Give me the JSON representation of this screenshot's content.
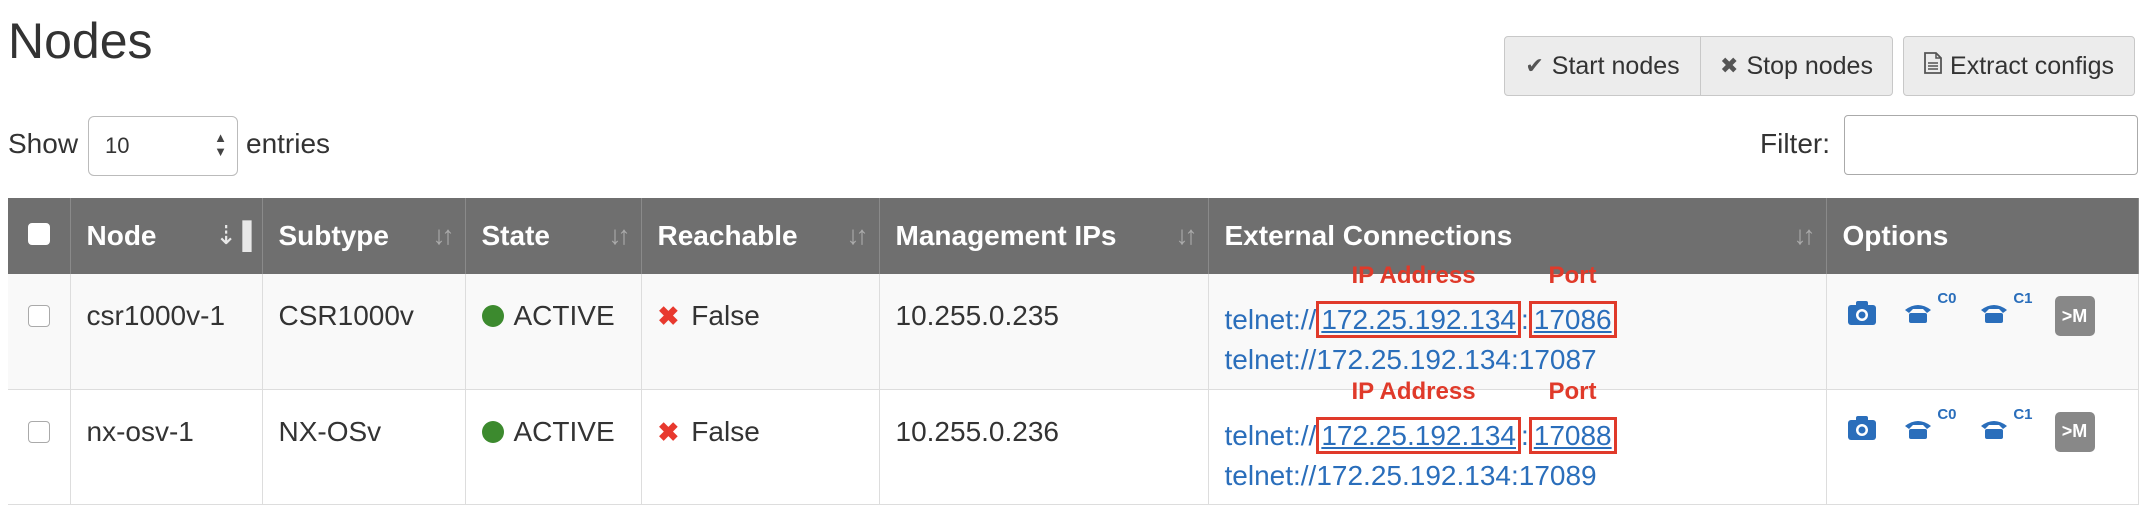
{
  "page": {
    "title": "Nodes"
  },
  "toolbar": {
    "start_label": "Start nodes",
    "stop_label": "Stop nodes",
    "extract_label": "Extract configs"
  },
  "controls": {
    "show_label": "Show",
    "show_value": "10",
    "entries_label": "entries",
    "filter_label": "Filter:",
    "filter_value": ""
  },
  "table": {
    "columns": [
      "Node",
      "Subtype",
      "State",
      "Reachable",
      "Management IPs",
      "External Connections",
      "Options"
    ],
    "rows": [
      {
        "node": "csr1000v-1",
        "subtype": "CSR1000v",
        "state": "ACTIVE",
        "reachable": "False",
        "mgmt_ip": "10.255.0.235",
        "conn1_prefix": "telnet://",
        "conn1_ip": "172.25.192.134",
        "conn1_sep": ":",
        "conn1_port": "17086",
        "conn2": "telnet://172.25.192.134:17087",
        "anno_ip": "IP Address",
        "anno_port": "Port",
        "opt_c0": "C0",
        "opt_c1": "C1",
        "opt_m": ">M"
      },
      {
        "node": "nx-osv-1",
        "subtype": "NX-OSv",
        "state": "ACTIVE",
        "reachable": "False",
        "mgmt_ip": "10.255.0.236",
        "conn1_prefix": "telnet://",
        "conn1_ip": "172.25.192.134",
        "conn1_sep": ":",
        "conn1_port": "17088",
        "conn2": "telnet://172.25.192.134:17089",
        "anno_ip": "IP Address",
        "anno_port": "Port",
        "opt_c0": "C0",
        "opt_c1": "C1",
        "opt_m": ">M"
      }
    ]
  },
  "colors": {
    "header_bg": "#6f6f6f",
    "link": "#2a6ebb",
    "active_dot": "#3c8a2e",
    "false_mark": "#e8392e",
    "annotation": "#e03a2a"
  },
  "icons": [
    "check-icon",
    "x-icon",
    "file-icon",
    "camera-icon",
    "phone-icon",
    "terminal-icon",
    "sort-icon",
    "status-dot-icon"
  ]
}
